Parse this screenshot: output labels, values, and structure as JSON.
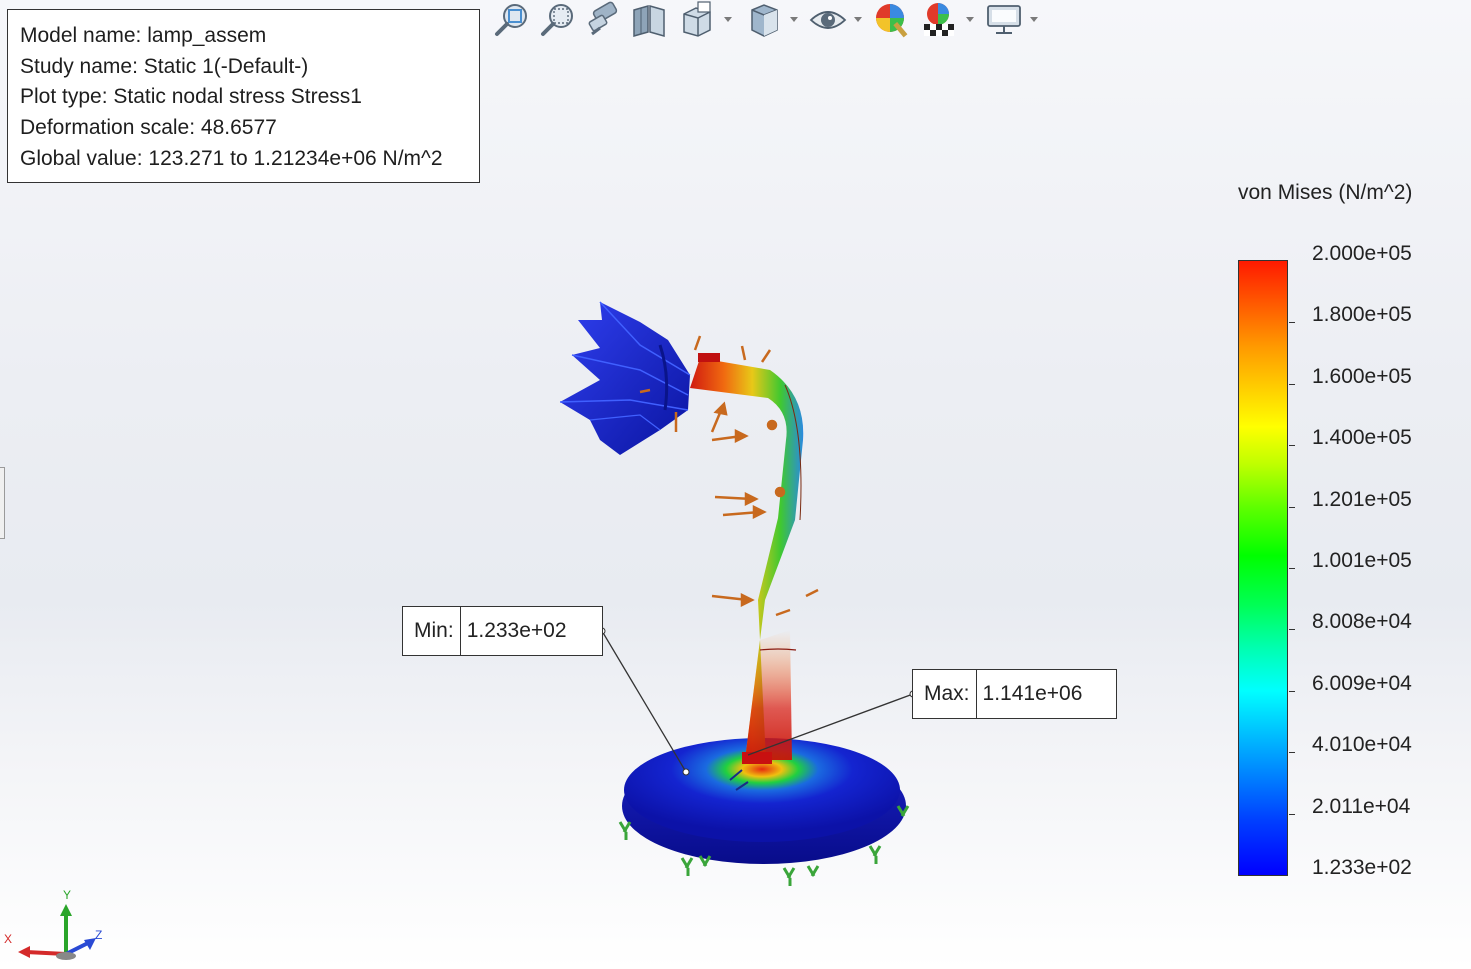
{
  "info_box": {
    "model_name": "Model name: lamp_assem",
    "study_name": "Study name: Static 1(-Default-)",
    "plot_type": "Plot type: Static nodal stress Stress1",
    "deformation_scale": "Deformation scale: 48.6577",
    "global_value": "Global value: 123.271 to 1.21234e+06 N/m^2"
  },
  "toolbar": {
    "buttons": [
      {
        "icon": "zoom-to-fit-icon"
      },
      {
        "icon": "zoom-to-area-icon"
      },
      {
        "icon": "previous-view-icon"
      },
      {
        "icon": "section-view-icon"
      },
      {
        "icon": "view-orientation-icon",
        "dropdown": true
      },
      {
        "icon": "display-style-icon",
        "dropdown": true
      },
      {
        "icon": "hide-show-items-icon",
        "dropdown": true
      },
      {
        "icon": "edit-appearance-icon"
      },
      {
        "icon": "apply-scene-icon",
        "dropdown": true
      },
      {
        "icon": "view-settings-icon",
        "dropdown": true
      }
    ]
  },
  "legend": {
    "title": "von Mises (N/m^2)",
    "labels": [
      "2.000e+05",
      "1.800e+05",
      "1.600e+05",
      "1.400e+05",
      "1.201e+05",
      "1.001e+05",
      "8.008e+04",
      "6.009e+04",
      "4.010e+04",
      "2.011e+04",
      "1.233e+02"
    ],
    "colors": {
      "max": "#ff1a00",
      "min": "#0000ff"
    }
  },
  "min_probe": {
    "label": "Min:",
    "value": "1.233e+02"
  },
  "max_probe": {
    "label": "Max:",
    "value": "1.141e+06"
  },
  "triad": {
    "x": "X",
    "y": "Y",
    "z": "Z"
  },
  "colors": {
    "load_arrow": "#c8691e",
    "fixture": "#3aa53a",
    "base_blue": "#1a1ad6"
  }
}
